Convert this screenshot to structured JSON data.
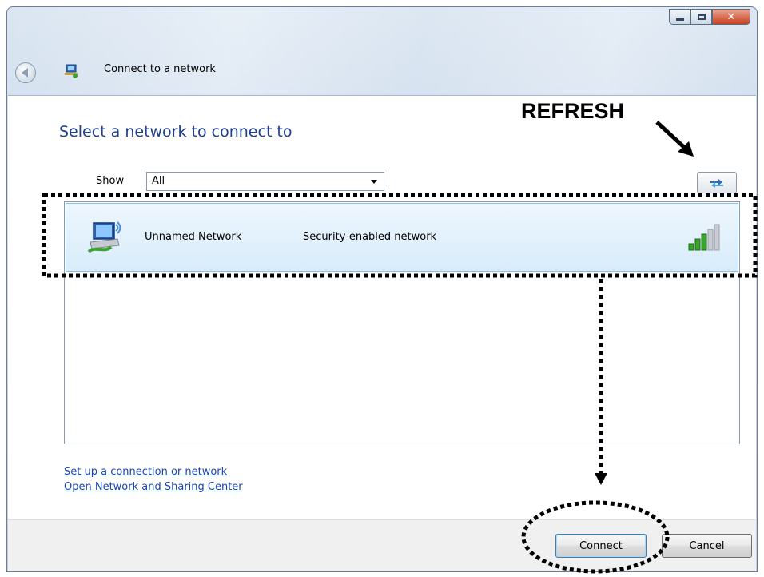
{
  "window": {
    "title": "Connect to a network",
    "caption_buttons": {
      "minimize_icon": "minimize-icon",
      "maximize_icon": "maximize-icon",
      "close_icon": "close-icon"
    }
  },
  "main": {
    "heading": "Select a network to connect to",
    "show_label": "Show",
    "show_select_value": "All",
    "networks": [
      {
        "name": "Unnamed Network",
        "security": "Security-enabled network",
        "signal_bars_filled": 3,
        "signal_bars_total": 5
      }
    ]
  },
  "links": {
    "setup": "Set up a connection or network",
    "sharing_center": "Open Network and Sharing Center"
  },
  "buttons": {
    "connect": "Connect",
    "cancel": "Cancel"
  },
  "annotation": {
    "refresh_label": "REFRESH"
  },
  "colors": {
    "heading": "#1e3e8f",
    "link": "#1a45b8",
    "selection": "#d8ecfa",
    "signal_active": "#3aa22f"
  }
}
